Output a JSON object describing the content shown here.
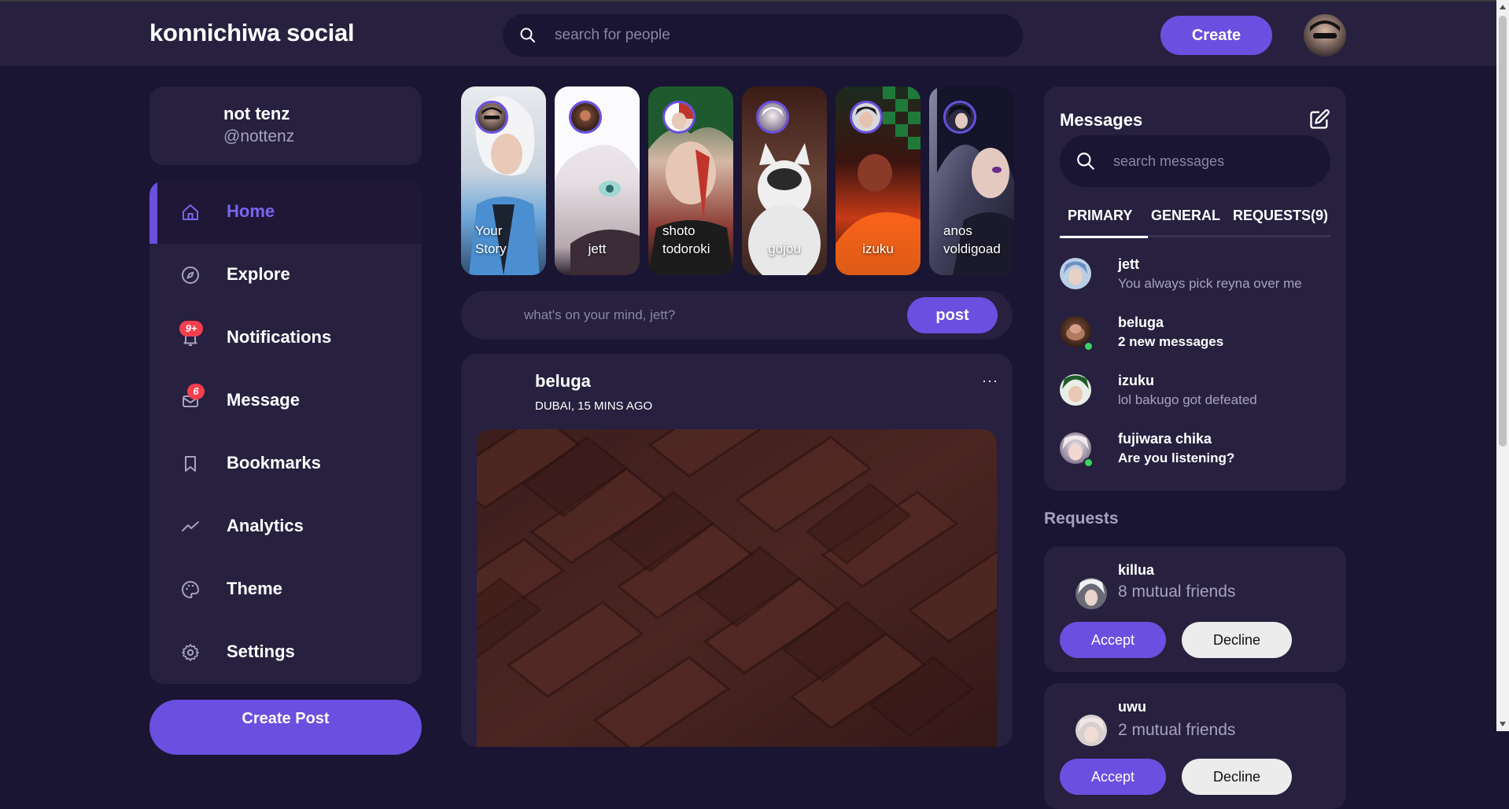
{
  "app": {
    "logo": "konnichiwa social"
  },
  "nav": {
    "search_placeholder": "search for people",
    "create_label": "Create"
  },
  "profile": {
    "name": "not tenz",
    "handle": "@nottenz"
  },
  "sidebar": {
    "items": [
      {
        "label": "Home",
        "icon": "home-icon",
        "active": true
      },
      {
        "label": "Explore",
        "icon": "compass-icon"
      },
      {
        "label": "Notifications",
        "icon": "bell-icon",
        "badge": "9+"
      },
      {
        "label": "Message",
        "icon": "mail-icon",
        "badge": "6"
      },
      {
        "label": "Bookmarks",
        "icon": "bookmark-icon"
      },
      {
        "label": "Analytics",
        "icon": "trend-icon"
      },
      {
        "label": "Theme",
        "icon": "palette-icon"
      },
      {
        "label": "Settings",
        "icon": "gear-icon"
      }
    ],
    "create_post_label": "Create Post"
  },
  "stories": [
    {
      "name": "Your\nStory"
    },
    {
      "name": "jett"
    },
    {
      "name": "shoto\ntodoroki"
    },
    {
      "name": "gojou"
    },
    {
      "name": "izuku"
    },
    {
      "name": "anos\nvoldigoad"
    }
  ],
  "compose": {
    "placeholder": "what's on your mind, jett?",
    "post_label": "post"
  },
  "feed": [
    {
      "author": "beluga",
      "meta": "DUBAI, 15 MINS AGO",
      "more": "···"
    }
  ],
  "messages": {
    "title": "Messages",
    "search_placeholder": "search messages",
    "tabs": [
      "PRIMARY",
      "GENERAL",
      "REQUESTS(9)"
    ],
    "items": [
      {
        "name": "jett",
        "text": "You always pick reyna over me",
        "unread": false,
        "online": false
      },
      {
        "name": "beluga",
        "text": "2 new messages",
        "unread": true,
        "online": true
      },
      {
        "name": "izuku",
        "text": "lol bakugo got defeated",
        "unread": false,
        "online": false
      },
      {
        "name": "fujiwara chika",
        "text": "Are you listening?",
        "unread": true,
        "online": true
      }
    ]
  },
  "requests": {
    "title": "Requests",
    "items": [
      {
        "name": "killua",
        "mutual": "8 mutual friends",
        "accept": "Accept",
        "decline": "Decline"
      },
      {
        "name": "uwu",
        "mutual": "2 mutual friends",
        "accept": "Accept",
        "decline": "Decline"
      }
    ]
  },
  "colors": {
    "bg": "#1a1533",
    "card": "#27203f",
    "accent": "#6a4fe0",
    "badge": "#f33f4f",
    "online": "#39d35f"
  }
}
